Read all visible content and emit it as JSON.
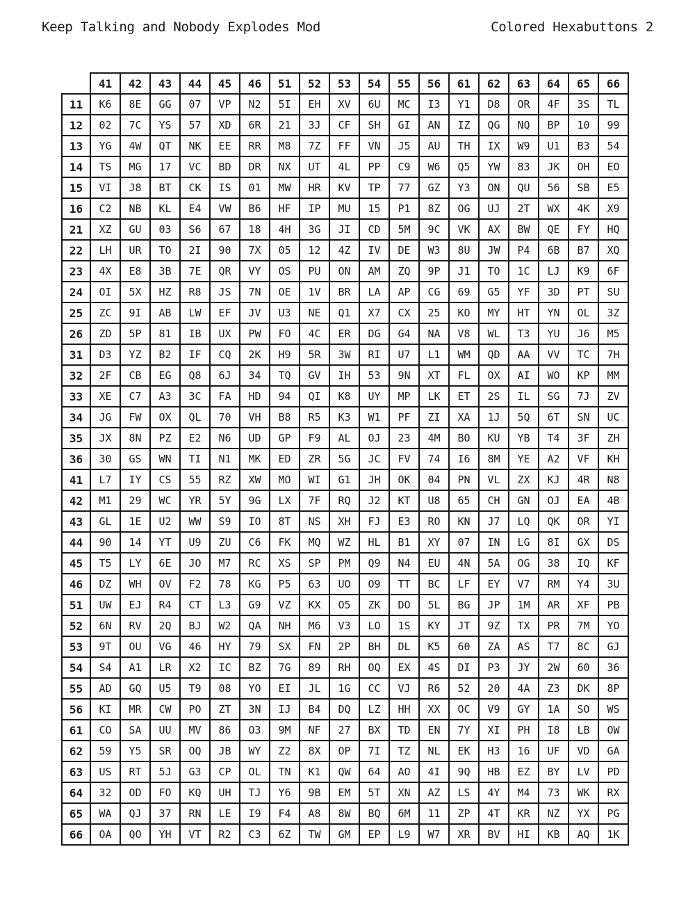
{
  "header": {
    "left": "Keep Talking and Nobody Explodes Mod",
    "right": "Colored Hexabuttons 2"
  },
  "table": {
    "columns": [
      "41",
      "42",
      "43",
      "44",
      "45",
      "46",
      "51",
      "52",
      "53",
      "54",
      "55",
      "56",
      "61",
      "62",
      "63",
      "64",
      "65",
      "66"
    ],
    "rows": [
      {
        "label": "11",
        "cells": [
          "K6",
          "8E",
          "GG",
          "07",
          "VP",
          "N2",
          "5I",
          "EH",
          "XV",
          "6U",
          "MC",
          "I3",
          "Y1",
          "D8",
          "OR",
          "4F",
          "3S",
          "TL"
        ]
      },
      {
        "label": "12",
        "cells": [
          "02",
          "7C",
          "YS",
          "57",
          "XD",
          "6R",
          "21",
          "3J",
          "CF",
          "SH",
          "GI",
          "AN",
          "IZ",
          "QG",
          "NQ",
          "BP",
          "10",
          "99"
        ]
      },
      {
        "label": "13",
        "cells": [
          "YG",
          "4W",
          "QT",
          "NK",
          "EE",
          "RR",
          "M8",
          "7Z",
          "FF",
          "VN",
          "J5",
          "AU",
          "TH",
          "IX",
          "W9",
          "U1",
          "B3",
          "54"
        ]
      },
      {
        "label": "14",
        "cells": [
          "TS",
          "MG",
          "17",
          "VC",
          "BD",
          "DR",
          "NX",
          "UT",
          "4L",
          "PP",
          "C9",
          "W6",
          "Q5",
          "YW",
          "83",
          "JK",
          "OH",
          "EO"
        ]
      },
      {
        "label": "15",
        "cells": [
          "VI",
          "J8",
          "BT",
          "CK",
          "IS",
          "01",
          "MW",
          "HR",
          "KV",
          "TP",
          "77",
          "GZ",
          "Y3",
          "ON",
          "QU",
          "56",
          "SB",
          "E5"
        ]
      },
      {
        "label": "16",
        "cells": [
          "C2",
          "NB",
          "KL",
          "E4",
          "VW",
          "B6",
          "HF",
          "IP",
          "MU",
          "15",
          "P1",
          "8Z",
          "OG",
          "UJ",
          "2T",
          "WX",
          "4K",
          "X9"
        ]
      },
      {
        "label": "21",
        "cells": [
          "XZ",
          "GU",
          "03",
          "S6",
          "67",
          "18",
          "4H",
          "3G",
          "JI",
          "CD",
          "5M",
          "9C",
          "VK",
          "AX",
          "BW",
          "QE",
          "FY",
          "HQ"
        ]
      },
      {
        "label": "22",
        "cells": [
          "LH",
          "UR",
          "TO",
          "2I",
          "90",
          "7X",
          "05",
          "12",
          "4Z",
          "IV",
          "DE",
          "W3",
          "8U",
          "JW",
          "P4",
          "6B",
          "B7",
          "XQ"
        ]
      },
      {
        "label": "23",
        "cells": [
          "4X",
          "E8",
          "3B",
          "7E",
          "QR",
          "VY",
          "OS",
          "PU",
          "ON",
          "AM",
          "ZQ",
          "9P",
          "J1",
          "TO",
          "1C",
          "LJ",
          "K9",
          "6F"
        ]
      },
      {
        "label": "24",
        "cells": [
          "OI",
          "5X",
          "HZ",
          "R8",
          "JS",
          "7N",
          "OE",
          "1V",
          "BR",
          "LA",
          "AP",
          "CG",
          "69",
          "G5",
          "YF",
          "3D",
          "PT",
          "SU"
        ]
      },
      {
        "label": "25",
        "cells": [
          "ZC",
          "9I",
          "AB",
          "LW",
          "EF",
          "JV",
          "U3",
          "NE",
          "Q1",
          "X7",
          "CX",
          "25",
          "KO",
          "MY",
          "HT",
          "YN",
          "OL",
          "3Z"
        ]
      },
      {
        "label": "26",
        "cells": [
          "ZD",
          "5P",
          "81",
          "IB",
          "UX",
          "PW",
          "FO",
          "4C",
          "ER",
          "DG",
          "G4",
          "NA",
          "V8",
          "WL",
          "T3",
          "YU",
          "J6",
          "M5"
        ]
      },
      {
        "label": "31",
        "cells": [
          "D3",
          "YZ",
          "B2",
          "IF",
          "CQ",
          "2K",
          "H9",
          "5R",
          "3W",
          "RI",
          "U7",
          "L1",
          "WM",
          "QD",
          "AA",
          "VV",
          "TC",
          "7H"
        ]
      },
      {
        "label": "32",
        "cells": [
          "2F",
          "CB",
          "EG",
          "Q8",
          "6J",
          "34",
          "TQ",
          "GV",
          "IH",
          "53",
          "9N",
          "XT",
          "FL",
          "OX",
          "AI",
          "WO",
          "KP",
          "MM"
        ]
      },
      {
        "label": "33",
        "cells": [
          "XE",
          "C7",
          "A3",
          "3C",
          "FA",
          "HD",
          "94",
          "QI",
          "K8",
          "UY",
          "MP",
          "LK",
          "ET",
          "2S",
          "IL",
          "SG",
          "7J",
          "ZV"
        ]
      },
      {
        "label": "34",
        "cells": [
          "JG",
          "FW",
          "OX",
          "QL",
          "70",
          "VH",
          "B8",
          "R5",
          "K3",
          "W1",
          "PF",
          "ZI",
          "XA",
          "1J",
          "5Q",
          "6T",
          "SN",
          "UC"
        ]
      },
      {
        "label": "35",
        "cells": [
          "JX",
          "8N",
          "PZ",
          "E2",
          "N6",
          "UD",
          "GP",
          "F9",
          "AL",
          "OJ",
          "23",
          "4M",
          "BO",
          "KU",
          "YB",
          "T4",
          "3F",
          "ZH"
        ]
      },
      {
        "label": "36",
        "cells": [
          "30",
          "GS",
          "WN",
          "TI",
          "N1",
          "MK",
          "ED",
          "ZR",
          "5G",
          "JC",
          "FV",
          "74",
          "I6",
          "8M",
          "YE",
          "A2",
          "VF",
          "KH"
        ]
      },
      {
        "label": "41",
        "cells": [
          "L7",
          "IY",
          "CS",
          "55",
          "RZ",
          "XW",
          "MO",
          "WI",
          "G1",
          "JH",
          "OK",
          "04",
          "PN",
          "VL",
          "ZX",
          "KJ",
          "4R",
          "N8"
        ]
      },
      {
        "label": "42",
        "cells": [
          "M1",
          "29",
          "WC",
          "YR",
          "5Y",
          "9G",
          "LX",
          "7F",
          "RQ",
          "J2",
          "KT",
          "U8",
          "65",
          "CH",
          "GN",
          "OJ",
          "EA",
          "4B"
        ]
      },
      {
        "label": "43",
        "cells": [
          "GL",
          "1E",
          "U2",
          "WW",
          "S9",
          "IO",
          "8T",
          "NS",
          "XH",
          "FJ",
          "E3",
          "RO",
          "KN",
          "J7",
          "LQ",
          "QK",
          "OR",
          "YI"
        ]
      },
      {
        "label": "44",
        "cells": [
          "90",
          "14",
          "YT",
          "U9",
          "ZU",
          "C6",
          "FK",
          "MQ",
          "WZ",
          "HL",
          "B1",
          "XY",
          "07",
          "IN",
          "LG",
          "8I",
          "GX",
          "DS"
        ]
      },
      {
        "label": "45",
        "cells": [
          "T5",
          "LY",
          "6E",
          "JO",
          "M7",
          "RC",
          "XS",
          "SP",
          "PM",
          "Q9",
          "N4",
          "EU",
          "4N",
          "5A",
          "OG",
          "38",
          "IQ",
          "KF"
        ]
      },
      {
        "label": "46",
        "cells": [
          "DZ",
          "WH",
          "OV",
          "F2",
          "78",
          "KG",
          "P5",
          "63",
          "UO",
          "O9",
          "TT",
          "BC",
          "LF",
          "EY",
          "V7",
          "RM",
          "Y4",
          "3U"
        ]
      },
      {
        "label": "51",
        "cells": [
          "UW",
          "EJ",
          "R4",
          "CT",
          "L3",
          "G9",
          "VZ",
          "KX",
          "O5",
          "ZK",
          "DO",
          "5L",
          "BG",
          "JP",
          "1M",
          "AR",
          "XF",
          "PB"
        ]
      },
      {
        "label": "52",
        "cells": [
          "6N",
          "RV",
          "2Q",
          "BJ",
          "W2",
          "QA",
          "NH",
          "M6",
          "V3",
          "LO",
          "1S",
          "KY",
          "JT",
          "9Z",
          "TX",
          "PR",
          "7M",
          "YO"
        ]
      },
      {
        "label": "53",
        "cells": [
          "9T",
          "OU",
          "VG",
          "46",
          "HY",
          "79",
          "SX",
          "FN",
          "2P",
          "BH",
          "DL",
          "K5",
          "60",
          "ZA",
          "AS",
          "T7",
          "8C",
          "GJ"
        ]
      },
      {
        "label": "54",
        "cells": [
          "S4",
          "A1",
          "LR",
          "X2",
          "IC",
          "BZ",
          "7G",
          "89",
          "RH",
          "OQ",
          "EX",
          "4S",
          "DI",
          "P3",
          "JY",
          "2W",
          "60",
          "36"
        ]
      },
      {
        "label": "55",
        "cells": [
          "AD",
          "GQ",
          "U5",
          "T9",
          "08",
          "YO",
          "EI",
          "JL",
          "1G",
          "CC",
          "VJ",
          "R6",
          "52",
          "20",
          "4A",
          "Z3",
          "DK",
          "8P"
        ]
      },
      {
        "label": "56",
        "cells": [
          "KI",
          "MR",
          "CW",
          "PO",
          "ZT",
          "3N",
          "IJ",
          "B4",
          "DQ",
          "LZ",
          "HH",
          "XX",
          "OC",
          "V9",
          "GY",
          "1A",
          "SO",
          "WS"
        ]
      },
      {
        "label": "61",
        "cells": [
          "CO",
          "SA",
          "UU",
          "MV",
          "86",
          "O3",
          "9M",
          "NF",
          "27",
          "BX",
          "TD",
          "EN",
          "7Y",
          "XI",
          "PH",
          "I8",
          "LB",
          "OW"
        ]
      },
      {
        "label": "62",
        "cells": [
          "59",
          "Y5",
          "SR",
          "OQ",
          "JB",
          "WY",
          "Z2",
          "8X",
          "OP",
          "7I",
          "TZ",
          "NL",
          "EK",
          "H3",
          "16",
          "UF",
          "VD",
          "GA"
        ]
      },
      {
        "label": "63",
        "cells": [
          "US",
          "RT",
          "5J",
          "G3",
          "CP",
          "OL",
          "TN",
          "K1",
          "QW",
          "64",
          "AO",
          "4I",
          "9Q",
          "HB",
          "EZ",
          "BY",
          "LV",
          "PD"
        ]
      },
      {
        "label": "64",
        "cells": [
          "32",
          "OD",
          "FO",
          "KQ",
          "UH",
          "TJ",
          "Y6",
          "9B",
          "EM",
          "5T",
          "XN",
          "AZ",
          "LS",
          "4Y",
          "M4",
          "73",
          "WK",
          "RX"
        ]
      },
      {
        "label": "65",
        "cells": [
          "WA",
          "QJ",
          "37",
          "RN",
          "LE",
          "I9",
          "F4",
          "A8",
          "8W",
          "BQ",
          "6M",
          "11",
          "ZP",
          "4T",
          "KR",
          "NZ",
          "YX",
          "PG"
        ]
      },
      {
        "label": "66",
        "cells": [
          "OA",
          "QO",
          "YH",
          "VT",
          "R2",
          "C3",
          "6Z",
          "TW",
          "GM",
          "EP",
          "L9",
          "W7",
          "XR",
          "BV",
          "HI",
          "KB",
          "AQ",
          "1K"
        ]
      }
    ]
  }
}
